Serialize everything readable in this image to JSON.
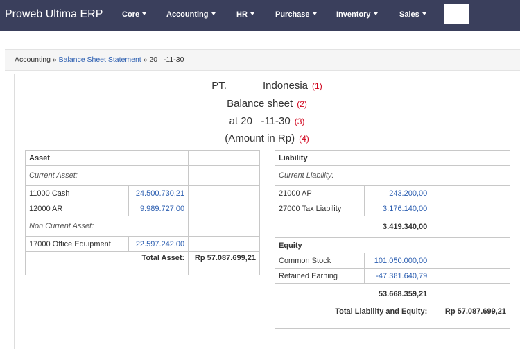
{
  "navbar": {
    "brand": "Proweb Ultima ERP",
    "menus": [
      "Core",
      "Accounting",
      "HR",
      "Purchase",
      "Inventory",
      "Sales"
    ]
  },
  "breadcrumb": {
    "root": "Accounting",
    "sep1": " » ",
    "link": "Balance Sheet Statement",
    "sep2": " » ",
    "current": "20   -11-30"
  },
  "report": {
    "company_left": "PT.",
    "company_right": "Indonesia",
    "title": "Balance sheet",
    "date": "at 20   -11-30",
    "currency": "(Amount in Rp)",
    "markers": [
      "(1)",
      "(2)",
      "(3)",
      "(4)"
    ]
  },
  "asset": {
    "heading": "Asset",
    "current_label": "Current Asset:",
    "current_items": [
      {
        "name": "11000 Cash",
        "amount": "24.500.730,21"
      },
      {
        "name": "12000 AR",
        "amount": "9.989.727,00"
      }
    ],
    "noncurrent_label": "Non Current Asset:",
    "noncurrent_items": [
      {
        "name": "17000 Office Equipment",
        "amount": "22.597.242,00"
      }
    ],
    "total_label": "Total Asset:",
    "total_value": "Rp 57.087.699,21"
  },
  "liability": {
    "heading": "Liability",
    "current_label": "Current Liability:",
    "items": [
      {
        "name": "21000 AP",
        "amount": "243.200,00"
      },
      {
        "name": "27000 Tax Liability",
        "amount": "3.176.140,00"
      }
    ],
    "subtotal": "3.419.340,00"
  },
  "equity": {
    "heading": "Equity",
    "items": [
      {
        "name": "Common Stock",
        "amount": "101.050.000,00"
      },
      {
        "name": "Retained Earning",
        "amount": "-47.381.640,79"
      }
    ],
    "subtotal": "53.668.359,21",
    "total_label": "Total Liability and Equity:",
    "total_value": "Rp 57.087.699,21"
  },
  "colors": {
    "navbar_bg": "#3a3f5c",
    "link": "#2a5db0",
    "marker": "#d0021b"
  }
}
